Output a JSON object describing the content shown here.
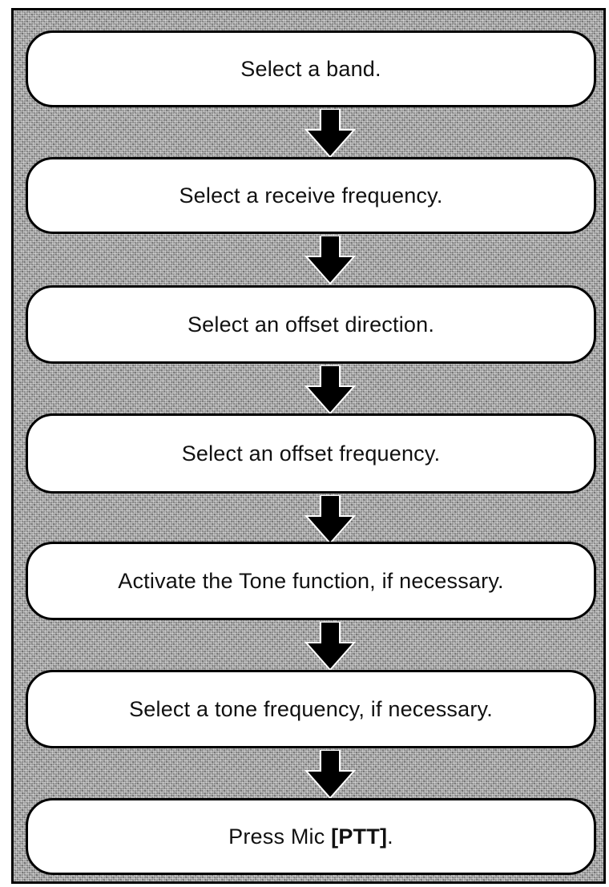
{
  "flowchart": {
    "steps": [
      {
        "text": "Select a band."
      },
      {
        "text": "Select a receive frequency."
      },
      {
        "text": "Select an offset direction."
      },
      {
        "text": "Select an offset frequency."
      },
      {
        "text": "Activate the Tone function, if necessary."
      },
      {
        "text": "Select a tone frequency, if necessary."
      },
      {
        "text_prefix": "Press Mic ",
        "text_bold": "[PTT]",
        "text_suffix": "."
      }
    ],
    "arrow_icon": "down-arrow-icon",
    "colors": {
      "box_fill": "#ffffff",
      "box_border": "#000000",
      "background": "#8f8f8f",
      "arrow": "#000000"
    }
  }
}
